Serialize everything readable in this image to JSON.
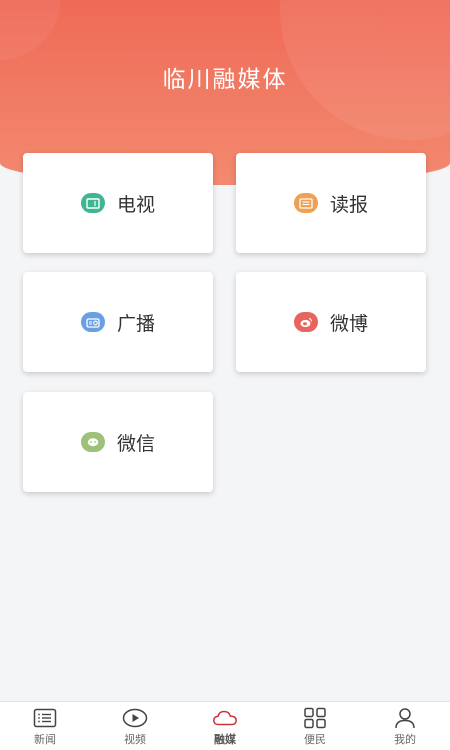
{
  "header": {
    "title": "临川融媒体"
  },
  "cards": [
    {
      "label": "电视",
      "icon": "tv-icon",
      "color": "#3fb594"
    },
    {
      "label": "读报",
      "icon": "newspaper-icon",
      "color": "#f0a053"
    },
    {
      "label": "广播",
      "icon": "radio-icon",
      "color": "#6aa0e3"
    },
    {
      "label": "微博",
      "icon": "weibo-icon",
      "color": "#e8645f"
    },
    {
      "label": "微信",
      "icon": "wechat-icon",
      "color": "#9ec17a"
    }
  ],
  "tabs": [
    {
      "label": "新闻",
      "icon": "news-list-icon",
      "active": false
    },
    {
      "label": "视频",
      "icon": "play-icon",
      "active": false
    },
    {
      "label": "融媒",
      "icon": "cloud-icon",
      "active": true
    },
    {
      "label": "便民",
      "icon": "grid-icon",
      "active": false
    },
    {
      "label": "我的",
      "icon": "user-icon",
      "active": false
    }
  ],
  "colors": {
    "header_top": "#ef6a57",
    "header_bottom": "#f38a6f",
    "active_tab": "#c9343a",
    "inactive_tab": "#444444"
  }
}
